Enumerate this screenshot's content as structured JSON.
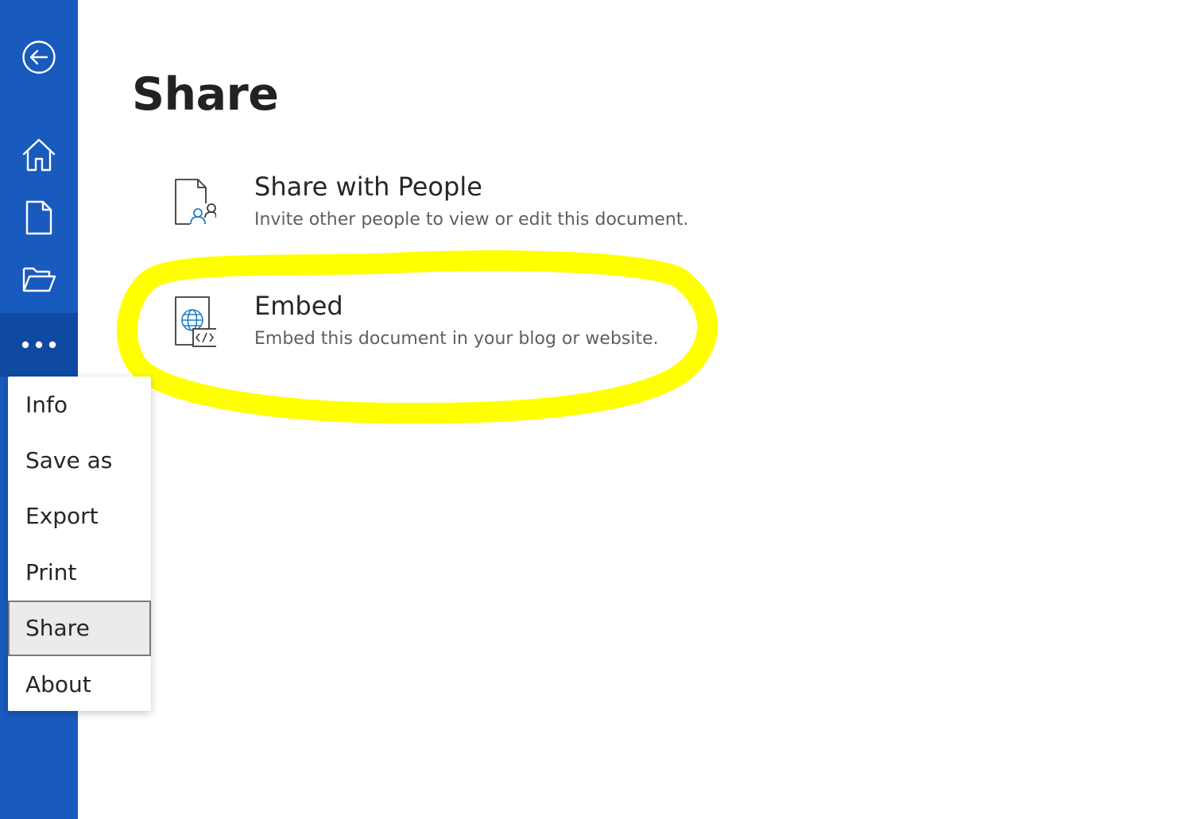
{
  "nav": {
    "back_icon": "back-arrow-circle-icon",
    "home_icon": "home-icon",
    "new_icon": "new-document-icon",
    "open_icon": "open-folder-icon",
    "more_icon": "more-ellipsis-icon"
  },
  "page": {
    "title": "Share"
  },
  "options": [
    {
      "title": "Share with People",
      "description": "Invite other people to view or edit this document.",
      "icon": "share-people-icon"
    },
    {
      "title": "Embed",
      "description": "Embed this document in your blog or website.",
      "icon": "embed-icon"
    }
  ],
  "menu": {
    "items": [
      "Info",
      "Save as",
      "Export",
      "Print",
      "Share",
      "About"
    ],
    "selected": "Share"
  },
  "colors": {
    "rail": "#185abd",
    "highlight": "#ffff00",
    "icon_accent": "#1e7ec8"
  }
}
